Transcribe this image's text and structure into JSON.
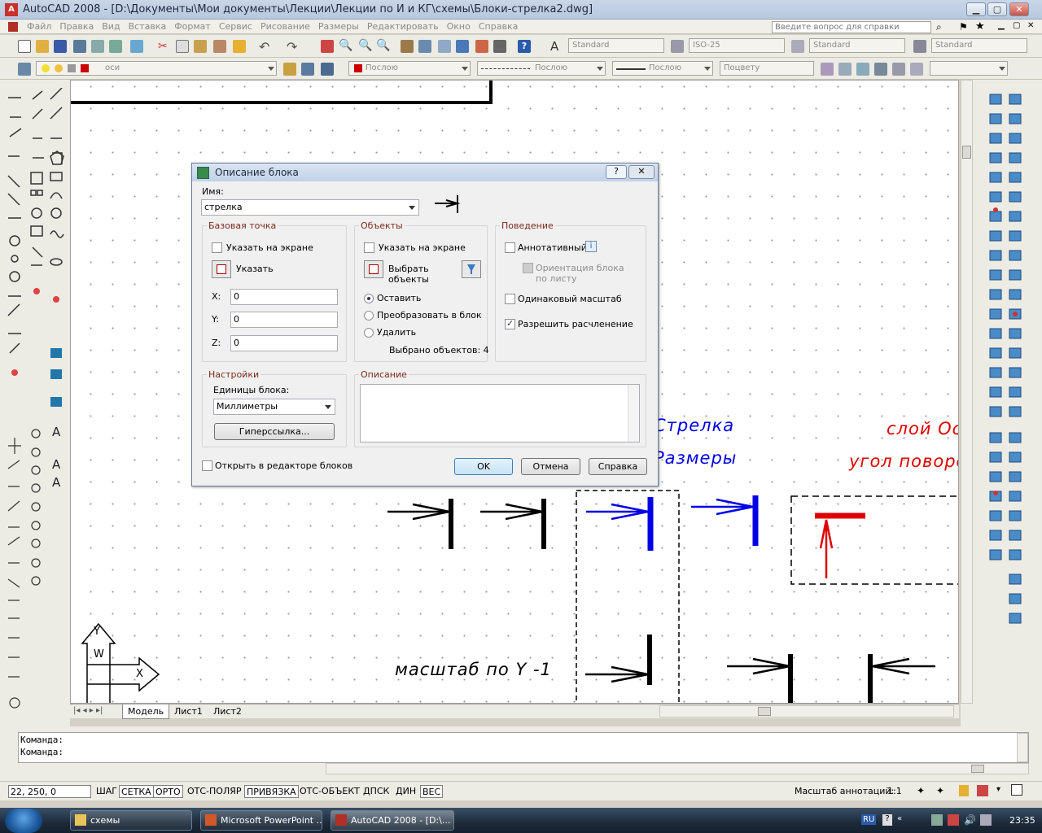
{
  "window": {
    "title": "AutoCAD 2008 - [D:\\Документы\\Мои документы\\Лекции\\Лекции по И и КГ\\схемы\\Блоки-стрелка2.dwg]"
  },
  "menu": {
    "items": [
      "Файл",
      "Правка",
      "Вид",
      "Вставка",
      "Формат",
      "Сервис",
      "Рисование",
      "Размеры",
      "Редактировать",
      "Окно",
      "Справка"
    ],
    "help_placeholder": "Введите вопрос для справки"
  },
  "toolbar": {
    "text_style": "Standard",
    "dim_style": "ISO-25",
    "table_style": "Standard",
    "mleader_style": "Standard",
    "layer": "оси",
    "color": "Послою",
    "linetype": "Послою",
    "lineweight": "Послою",
    "plotstyle": "Поцвету"
  },
  "dialog": {
    "title": "Описание блока",
    "name_label": "Имя:",
    "name_value": "стрелка",
    "base": {
      "title": "Базовая точка",
      "specify_on_screen": "Указать на экране",
      "pick_label": "Указать",
      "x_label": "X:",
      "x": "0",
      "y_label": "Y:",
      "y": "0",
      "z_label": "Z:",
      "z": "0"
    },
    "objects": {
      "title": "Объекты",
      "specify_on_screen": "Указать на экране",
      "select_label_1": "Выбрать",
      "select_label_2": "объекты",
      "retain": "Оставить",
      "convert": "Преобразовать в блок",
      "delete": "Удалить",
      "selected_count": "Выбрано объектов: 4"
    },
    "behavior": {
      "title": "Поведение",
      "annotative": "Аннотативный",
      "orient_1": "Ориентация блока",
      "orient_2": "по листу",
      "uniform_scale": "Одинаковый масштаб",
      "allow_explode": "Разрешить расчленение"
    },
    "settings": {
      "title": "Настройки",
      "units_label": "Единицы блока:",
      "units_value": "Миллиметры",
      "hyperlink": "Гиперссылка..."
    },
    "description": {
      "title": "Описание"
    },
    "open_in_editor": "Открыть в редакторе блоков",
    "ok": "OK",
    "cancel": "Отмена",
    "help": "Справка",
    "help_glyph": "?",
    "close_glyph": "✕"
  },
  "canvas": {
    "text_strelka": "Стрелка",
    "text_razmery": "Размеры",
    "text_layer": "слой Ос",
    "text_angle": "угол поворо",
    "text_scale": "масштаб по Y -1",
    "ucs_y": "Y",
    "ucs_w": "W",
    "ucs_x": "X"
  },
  "tabs": [
    "Модель",
    "Лист1",
    "Лист2"
  ],
  "command": {
    "line1": "Команда:",
    "line2": "Команда:"
  },
  "status": {
    "coords": "22, 250, 0",
    "toggles": [
      "ШАГ",
      "СЕТКА",
      "ОРТО",
      "ОТС-ПОЛЯР",
      "ПРИВЯЗКА",
      "ОТС-ОБЪЕКТ",
      "ДПСК",
      "ДИН",
      "ВЕС"
    ],
    "annot_scale_label": "Масштаб аннотаций:",
    "annot_scale": "1:1"
  },
  "taskbar": {
    "items": [
      "схемы",
      "Microsoft PowerPoint ...",
      "AutoCAD 2008 - [D:\\..."
    ],
    "lang": "RU",
    "time": "23:35"
  }
}
